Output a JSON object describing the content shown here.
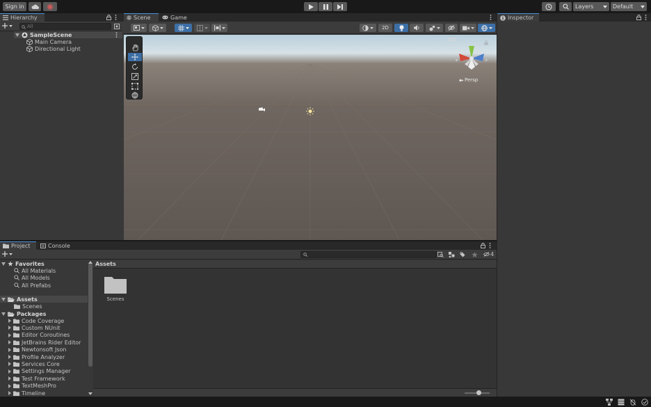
{
  "toolbar": {
    "sign_in": "Sign in",
    "layers": "Layers",
    "layout": "Default"
  },
  "hierarchy": {
    "tab": "Hierarchy",
    "search_placeholder": "All",
    "scene": "SampleScene",
    "items": [
      "Main Camera",
      "Directional Light"
    ]
  },
  "scene_view": {
    "tabs": [
      "Scene",
      "Game"
    ],
    "mode_2d": "2D",
    "persp_label": "Persp"
  },
  "inspector": {
    "tab": "Inspector"
  },
  "bottom": {
    "tabs": [
      "Project",
      "Console"
    ],
    "hidden_count": "4",
    "favorites": {
      "label": "Favorites",
      "items": [
        "All Materials",
        "All Models",
        "All Prefabs"
      ]
    },
    "assets": {
      "label": "Assets",
      "items": [
        "Scenes"
      ]
    },
    "packages": {
      "label": "Packages",
      "items": [
        "Code Coverage",
        "Custom NUnit",
        "Editor Coroutines",
        "JetBrains Rider Editor",
        "Newtonsoft Json",
        "Profile Analyzer",
        "Services Core",
        "Settings Manager",
        "Test Framework",
        "TextMeshPro",
        "Timeline"
      ]
    },
    "assets_header": "Assets",
    "grid_items": [
      {
        "name": "Scenes",
        "icon": "folder-icon"
      }
    ]
  },
  "colors": {
    "accent": "#4a90d9",
    "selection": "#3d6fa6",
    "panel": "#383838",
    "background": "#191919"
  }
}
